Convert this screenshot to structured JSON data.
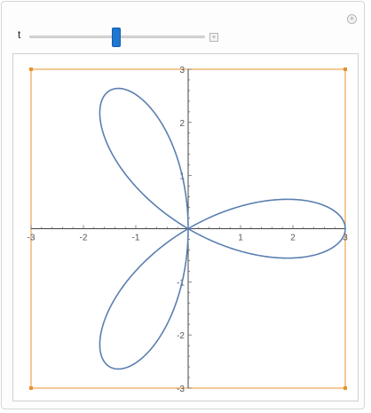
{
  "controls": {
    "variable_label": "t",
    "slider_fraction": 0.49
  },
  "colors": {
    "curve": "#5a7fb0",
    "frame": "#e8912d",
    "slider_thumb": "#1f77d0"
  },
  "chart_data": {
    "type": "line",
    "curve": "polar rose, three petals",
    "xlim": [
      -3,
      3
    ],
    "ylim": [
      -3,
      3
    ],
    "x_ticks": [
      -3,
      -2,
      -1,
      1,
      2,
      3
    ],
    "y_ticks": [
      -3,
      -2,
      -1,
      1,
      2,
      3
    ],
    "x_tick_labels": [
      "-3",
      "-2",
      "-1",
      "1",
      "2",
      "3"
    ],
    "y_tick_labels": [
      "-3",
      "-2",
      "-1",
      "1",
      "2",
      "3"
    ],
    "petal_tips": [
      {
        "x": 3.0,
        "y": 0.0
      },
      {
        "x": -1.5,
        "y": 2.6
      },
      {
        "x": -1.5,
        "y": -2.6
      }
    ],
    "grid": false
  }
}
